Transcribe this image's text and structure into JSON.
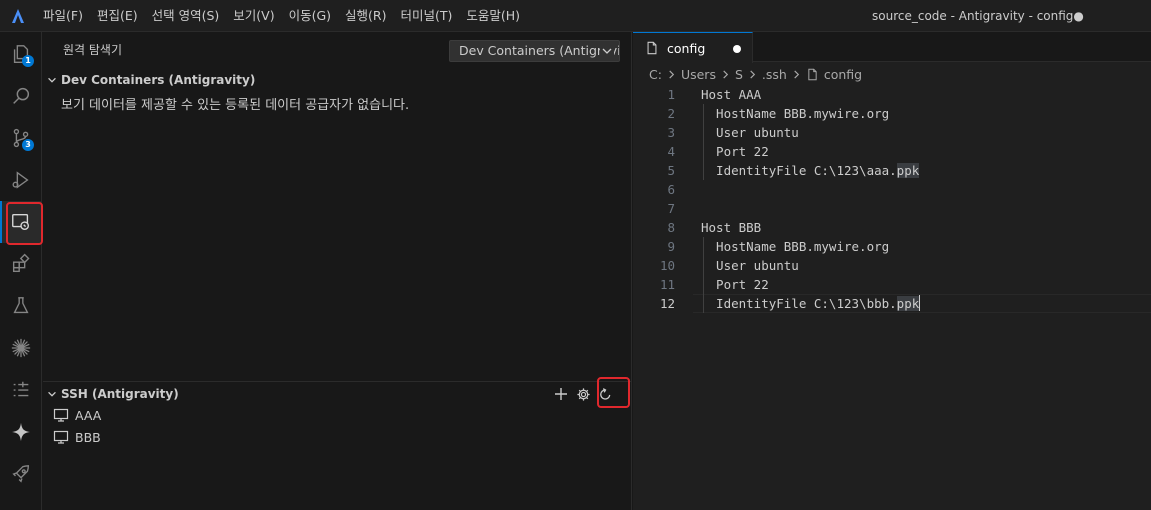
{
  "titlebar": {
    "menu": [
      "파일(F)",
      "편집(E)",
      "선택 영역(S)",
      "보기(V)",
      "이동(G)",
      "실행(R)",
      "터미널(T)",
      "도움말(H)"
    ],
    "window_title": "source_code - Antigravity - config●"
  },
  "activitybar": {
    "explorer_badge": "1",
    "scm_badge": "3",
    "icons": [
      "files-icon",
      "search-icon",
      "source-control-icon",
      "run-debug-icon",
      "remote-explorer-icon",
      "extensions-icon",
      "testing-icon",
      "sparkle-burst-icon",
      "task-list-icon",
      "agent-star-icon",
      "rocket-icon"
    ]
  },
  "sidebar": {
    "header": "원격 탐색기",
    "select_value": "Dev Containers (Antigravity)",
    "dev_containers": {
      "title": "Dev Containers (Antigravity)",
      "message": "보기 데이터를 제공할 수 있는 등록된 데이터 공급자가 없습니다."
    },
    "ssh": {
      "title": "SSH (Antigravity)",
      "hosts": [
        "AAA",
        "BBB"
      ]
    }
  },
  "editor": {
    "tab_label": "config",
    "breadcrumb": [
      "C:",
      "Users",
      "S",
      ".ssh",
      "config"
    ],
    "lines": [
      {
        "n": "1",
        "text": "Host AAA"
      },
      {
        "n": "2",
        "text": "  HostName BBB.mywire.org"
      },
      {
        "n": "3",
        "text": "  User ubuntu"
      },
      {
        "n": "4",
        "text": "  Port 22"
      },
      {
        "n": "5",
        "text": "  IdentityFile C:\\123\\aaa.",
        "hl": "ppk"
      },
      {
        "n": "6",
        "text": ""
      },
      {
        "n": "7",
        "text": ""
      },
      {
        "n": "8",
        "text": "Host BBB"
      },
      {
        "n": "9",
        "text": "  HostName BBB.mywire.org"
      },
      {
        "n": "10",
        "text": "  User ubuntu"
      },
      {
        "n": "11",
        "text": "  Port 22"
      },
      {
        "n": "12",
        "text": "  IdentityFile C:\\123\\bbb.",
        "hl": "ppk",
        "current": true
      }
    ]
  },
  "colors": {
    "accent": "#0078d4",
    "highlight_box": "#e0282d"
  }
}
